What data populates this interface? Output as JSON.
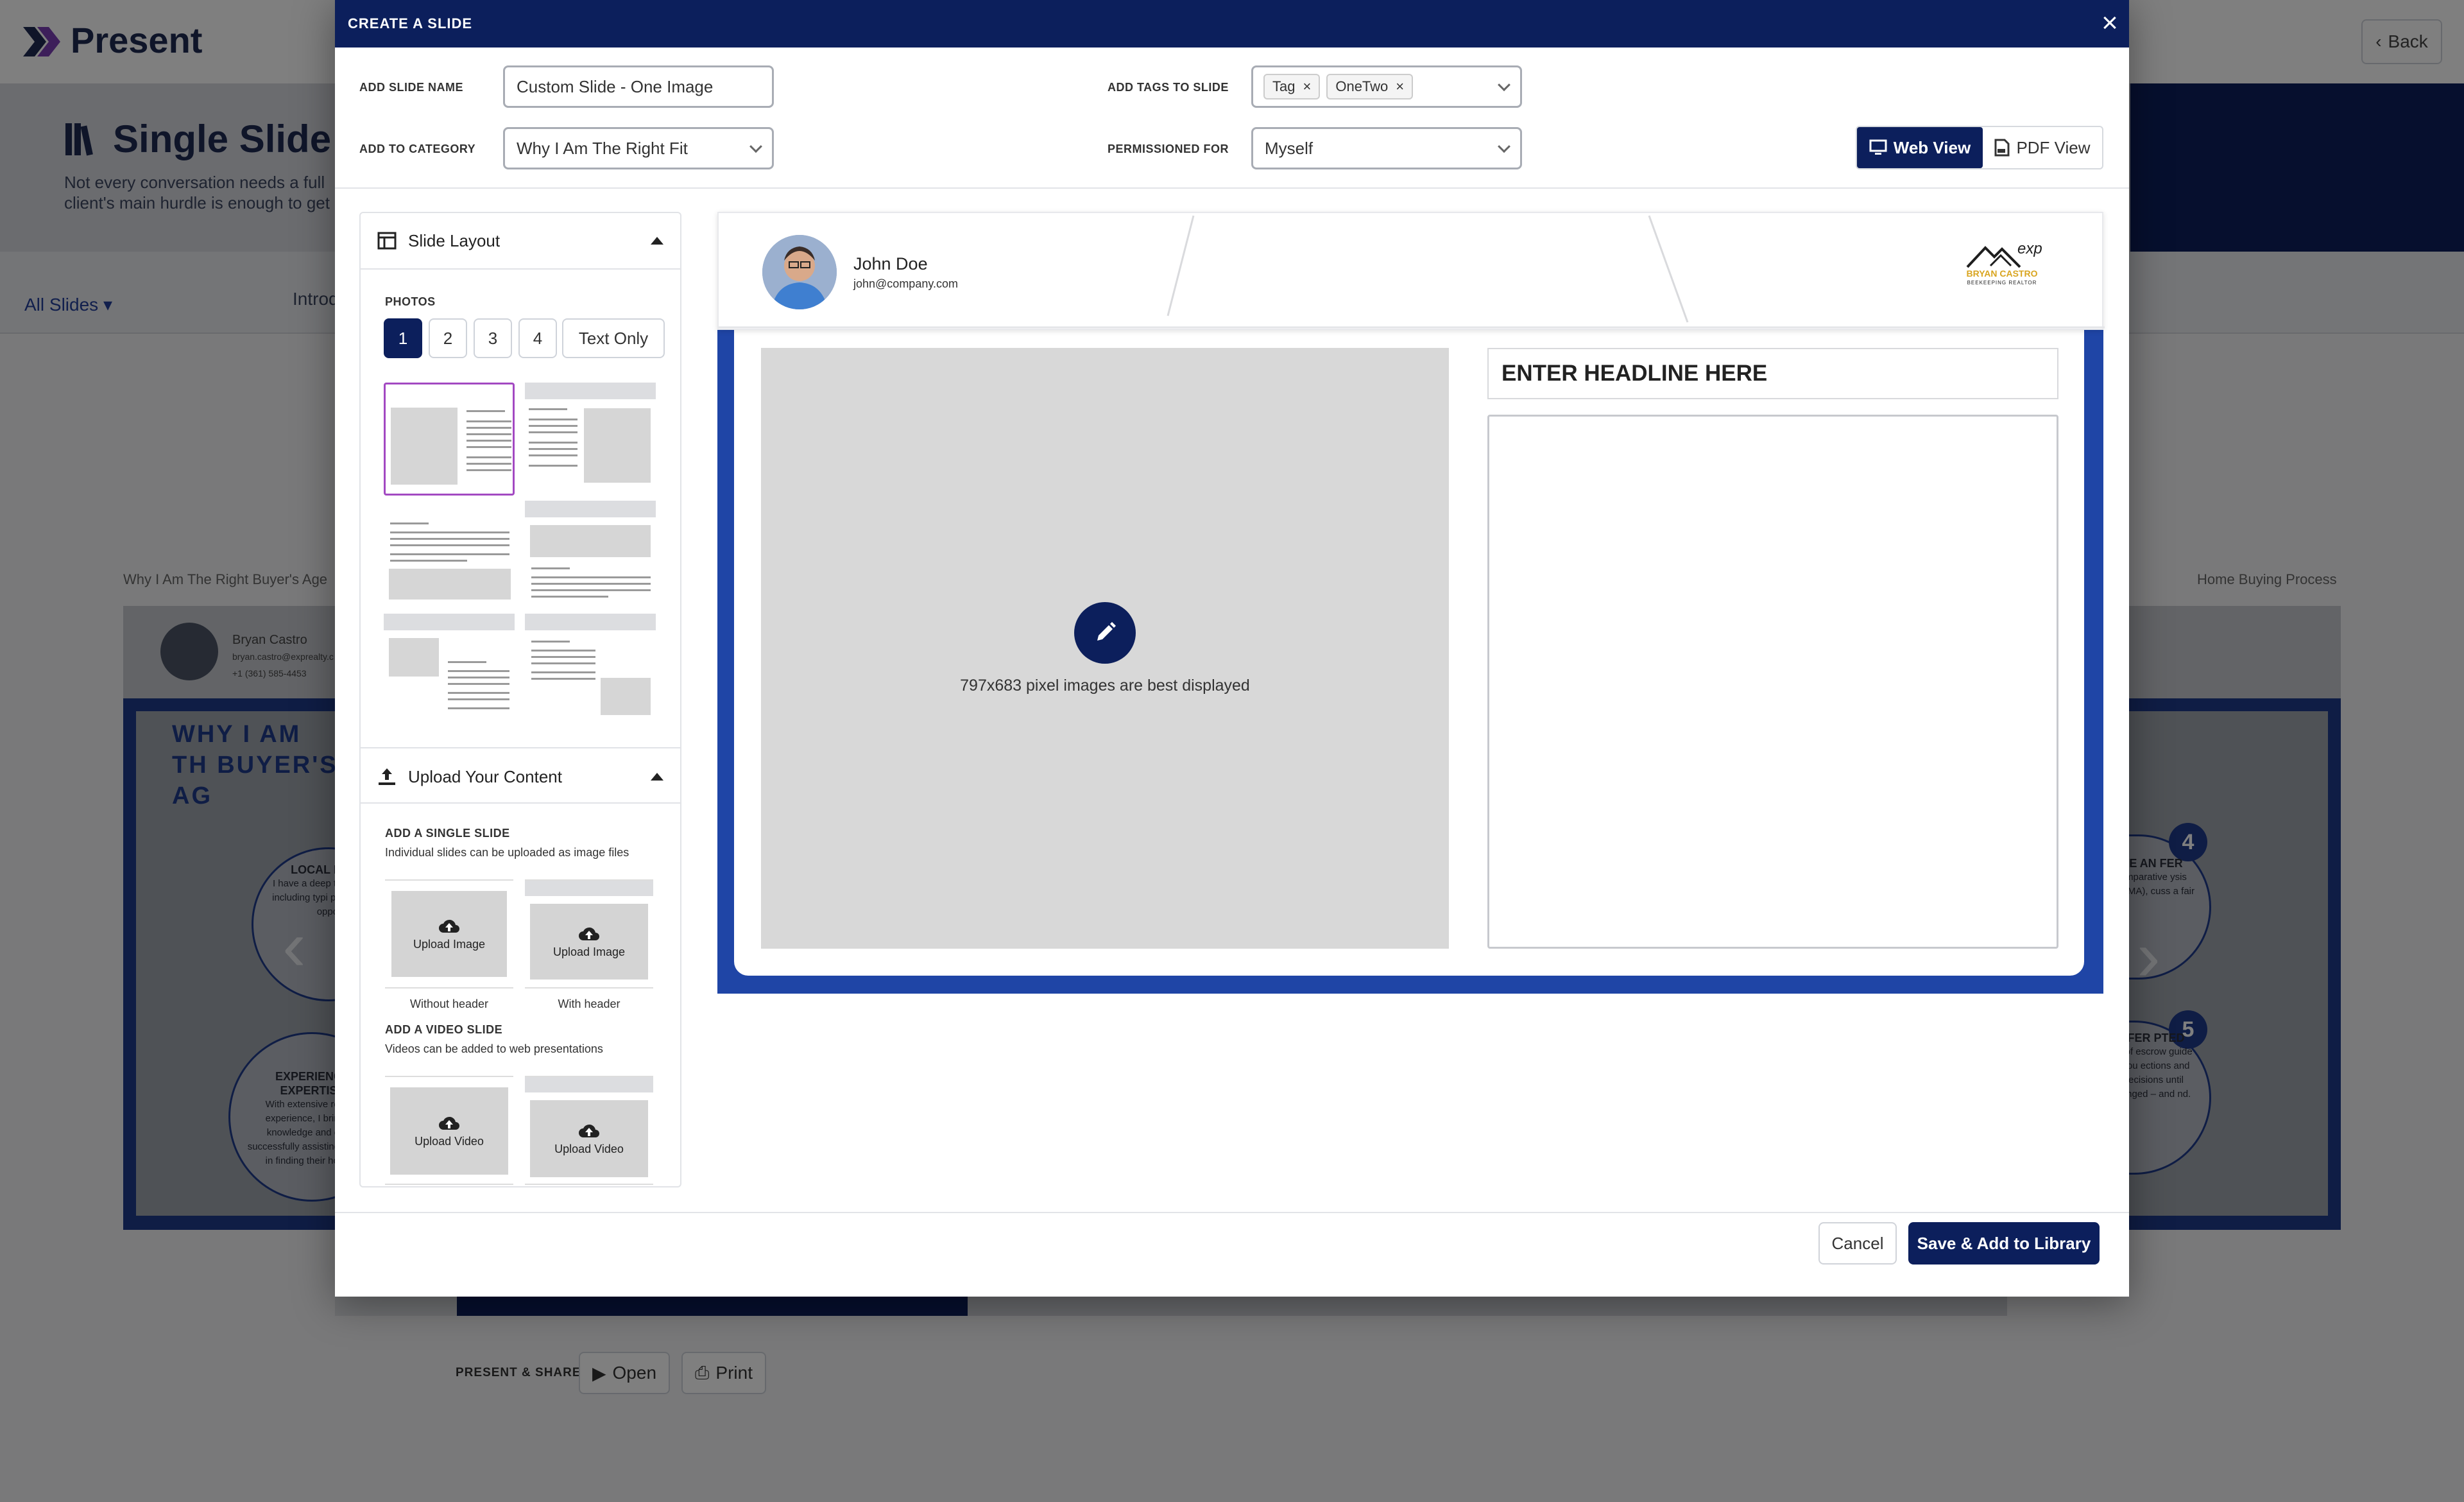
{
  "app": {
    "name": "Present",
    "back_label": "Back"
  },
  "page": {
    "title": "Single Slide Li",
    "subtitle": "Not every conversation needs a full client's main hurdle is enough to get",
    "filter_label": "All Slides",
    "tab_intro": "Introd",
    "category_left": "Why I Am The Right Buyer's Age",
    "category_right": "Home Buying Process"
  },
  "background_slide": {
    "agent_name": "Bryan Castro",
    "agent_email": "bryan.castro@exprealty.c",
    "agent_phone": "+1 (361) 585-4453",
    "title": "WHY I AM TH BUYER'S AG",
    "circles": [
      {
        "heading": "LOCAL KNOW",
        "text": "I have a deep the local real including typi proper valuati opport"
      },
      {
        "heading": "EXPERIENCE EXPERTISE",
        "text": "With extensive real es experience, I bring val knowledge and exper successfully assisting n clients in finding their homes."
      },
      {
        "num": "4",
        "heading": "E AN FER",
        "text": "mparative ysis (CMA), cuss a fair"
      },
      {
        "num": "5",
        "heading": "FER PTED",
        "text": "t of escrow guide you ections and ecisions until anged – and nd."
      }
    ]
  },
  "present_share": {
    "label": "PRESENT & SHARE",
    "open_label": "Open",
    "print_label": "Print"
  },
  "modal": {
    "title": "CREATE A SLIDE",
    "slide_name_label": "ADD SLIDE NAME",
    "slide_name_value": "Custom Slide - One Image",
    "category_label": "ADD TO CATEGORY",
    "category_value": "Why I Am The Right Fit",
    "tags_label": "ADD TAGS TO SLIDE",
    "tags": [
      "Tag",
      "OneTwo"
    ],
    "permission_label": "PERMISSIONED FOR",
    "permission_value": "Myself",
    "view_web": "Web View",
    "view_pdf": "PDF View",
    "layout_section": "Slide Layout",
    "photos_label": "PHOTOS",
    "photo_options": [
      "1",
      "2",
      "3",
      "4",
      "Text Only"
    ],
    "photo_selected": "1",
    "upload_section": "Upload Your Content",
    "single_slide_label": "ADD A SINGLE SLIDE",
    "single_slide_desc": "Individual slides can be uploaded as image files",
    "upload_image": "Upload Image",
    "without_header": "Without header",
    "with_header": "With header",
    "video_slide_label": "ADD A VIDEO SLIDE",
    "video_slide_desc": "Videos can be added to web presentations",
    "upload_video": "Upload Video",
    "cancel": "Cancel",
    "save": "Save & Add to Library"
  },
  "preview": {
    "agent_name": "John Doe",
    "agent_email": "john@company.com",
    "logo_top": "exp",
    "logo_name": "BRYAN CASTRO",
    "logo_sub": "BEEKEEPING REALTOR",
    "image_hint": "797x683 pixel images are best displayed",
    "headline": "ENTER HEADLINE HERE"
  },
  "colors": {
    "navy": "#0c1f5c",
    "blue_frame": "#1f45a6",
    "thumb_select": "#a349c2"
  }
}
